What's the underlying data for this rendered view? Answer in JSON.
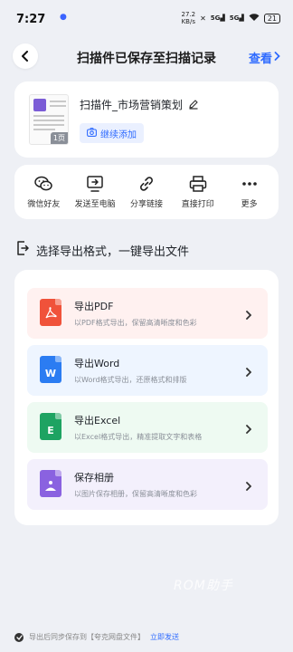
{
  "status": {
    "time": "7:27",
    "net_speed_value": "27.2",
    "net_speed_unit": "KB/s",
    "signal1": "5G",
    "signal2": "5G",
    "battery": "21"
  },
  "header": {
    "title": "扫描件已保存至扫描记录",
    "view_label": "查看"
  },
  "file": {
    "name": "扫描件_市场营销策划",
    "page_count": "1页",
    "continue_label": "继续添加"
  },
  "actions": [
    {
      "label": "微信好友",
      "icon": "wechat-icon"
    },
    {
      "label": "发送至电脑",
      "icon": "send-to-pc-icon"
    },
    {
      "label": "分享链接",
      "icon": "link-icon"
    },
    {
      "label": "直接打印",
      "icon": "printer-icon"
    },
    {
      "label": "更多",
      "icon": "more-icon"
    }
  ],
  "section": {
    "title": "选择导出格式，一键导出文件"
  },
  "export_options": [
    {
      "title": "导出PDF",
      "desc": "以PDF格式导出，保留高清晰度和色彩",
      "icon": "pdf-file-icon",
      "color": "#f0523a",
      "bg": "#fff1f0"
    },
    {
      "title": "导出Word",
      "desc": "以Word格式导出，还原格式和排版",
      "icon": "word-file-icon",
      "color": "#2b7cf2",
      "bg": "#eef5ff"
    },
    {
      "title": "导出Excel",
      "desc": "以Excel格式导出，精准提取文字和表格",
      "icon": "excel-file-icon",
      "color": "#1ea362",
      "bg": "#eefaf2"
    },
    {
      "title": "保存相册",
      "desc": "以图片保存相册，保留高清晰度和色彩",
      "icon": "image-file-icon",
      "color": "#8a62e0",
      "bg": "#f3f0fc"
    }
  ],
  "watermark": "ROM助手",
  "footer": {
    "text": "导出后同步保存到【夸克网盘文件】",
    "link": "立即发送"
  }
}
